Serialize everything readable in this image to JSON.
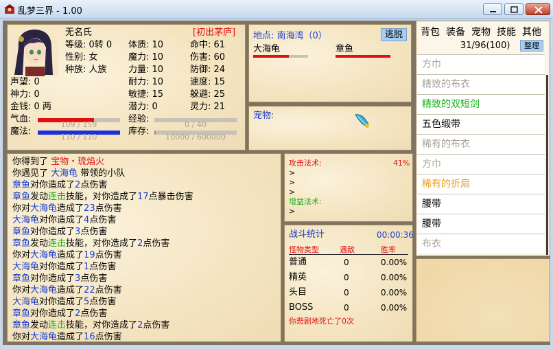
{
  "window": {
    "title": "乱梦三界 - 1.00"
  },
  "character": {
    "name": "无名氏",
    "location_tag": "[初出茅庐]",
    "level": "等级: 0转 0",
    "gender": "性别: 女",
    "race": "种族: 人族",
    "fame": "声望: 0",
    "spirit": "神力: 0",
    "money": "金钱: 0 两",
    "physique": "体质: 10",
    "magic_pow": "魔力: 10",
    "strength": "力量: 10",
    "endurance": "耐力: 10",
    "agility": "敏捷: 15",
    "potential": "潜力: 0",
    "hit": "命中: 61",
    "damage": "伤害: 60",
    "defense": "防御: 24",
    "speed": "速度: 15",
    "dodge": "躲避: 25",
    "spirit_power": "灵力: 21",
    "hp_label": "气血:",
    "hp_text": "109 / 159",
    "hp_fraction": 0.686,
    "mp_label": "魔法:",
    "mp_text": "110 / 110",
    "mp_fraction": 1.0,
    "exp_label": "经验:",
    "exp_text": "0 / 40",
    "exp_fraction": 0,
    "store_label": "库存:",
    "store_text": "10000 / 600000",
    "store_fraction": 0.017,
    "colors": {
      "hp": "#e01010",
      "mp": "#1a2fe0",
      "exp": "#c8c2b6"
    }
  },
  "location": {
    "label": "地点: 南海湾（0）",
    "flee_button": "逃脱",
    "monsters": [
      {
        "name": "大海龟",
        "hp_fraction": 0.65
      },
      {
        "name": "章鱼",
        "hp_fraction": 1.0
      }
    ]
  },
  "pet": {
    "label": "宠物:"
  },
  "log": {
    "lines": [
      [
        {
          "t": "你得到了 "
        },
        {
          "t": "宝物・琉焰火",
          "c": "red"
        }
      ],
      [
        {
          "t": "你遇见了 "
        },
        {
          "t": "大海龟",
          "c": "blue"
        },
        {
          "t": " 带领的小队"
        }
      ],
      [
        {
          "t": "章鱼",
          "c": "blue"
        },
        {
          "t": "对你造成了"
        },
        {
          "t": "2",
          "c": "num"
        },
        {
          "t": "点伤害"
        }
      ],
      [
        {
          "t": "章鱼",
          "c": "blue"
        },
        {
          "t": "发动"
        },
        {
          "t": "连击",
          "c": "green"
        },
        {
          "t": "技能，对你造成了"
        },
        {
          "t": "17",
          "c": "num"
        },
        {
          "t": "点暴击伤害"
        }
      ],
      [
        {
          "t": "你对"
        },
        {
          "t": "大海龟",
          "c": "blue"
        },
        {
          "t": "造成了"
        },
        {
          "t": "23",
          "c": "num"
        },
        {
          "t": "点伤害"
        }
      ],
      [
        {
          "t": "大海龟",
          "c": "blue"
        },
        {
          "t": "对你造成了"
        },
        {
          "t": "4",
          "c": "num"
        },
        {
          "t": "点伤害"
        }
      ],
      [
        {
          "t": "章鱼",
          "c": "blue"
        },
        {
          "t": "对你造成了"
        },
        {
          "t": "3",
          "c": "num"
        },
        {
          "t": "点伤害"
        }
      ],
      [
        {
          "t": "章鱼",
          "c": "blue"
        },
        {
          "t": "发动"
        },
        {
          "t": "连击",
          "c": "green"
        },
        {
          "t": "技能，对你造成了"
        },
        {
          "t": "2",
          "c": "num"
        },
        {
          "t": "点伤害"
        }
      ],
      [
        {
          "t": "你对"
        },
        {
          "t": "大海龟",
          "c": "blue"
        },
        {
          "t": "造成了"
        },
        {
          "t": "19",
          "c": "num"
        },
        {
          "t": "点伤害"
        }
      ],
      [
        {
          "t": "大海龟",
          "c": "blue"
        },
        {
          "t": "对你造成了"
        },
        {
          "t": "1",
          "c": "num"
        },
        {
          "t": "点伤害"
        }
      ],
      [
        {
          "t": "章鱼",
          "c": "blue"
        },
        {
          "t": "对你造成了"
        },
        {
          "t": "3",
          "c": "num"
        },
        {
          "t": "点伤害"
        }
      ],
      [
        {
          "t": "你对"
        },
        {
          "t": "大海龟",
          "c": "blue"
        },
        {
          "t": "造成了"
        },
        {
          "t": "22",
          "c": "num"
        },
        {
          "t": "点伤害"
        }
      ],
      [
        {
          "t": "大海龟",
          "c": "blue"
        },
        {
          "t": "对你造成了"
        },
        {
          "t": "5",
          "c": "num"
        },
        {
          "t": "点伤害"
        }
      ],
      [
        {
          "t": "章鱼",
          "c": "blue"
        },
        {
          "t": "对你造成了"
        },
        {
          "t": "2",
          "c": "num"
        },
        {
          "t": "点伤害"
        }
      ],
      [
        {
          "t": "章鱼",
          "c": "blue"
        },
        {
          "t": "发动"
        },
        {
          "t": "连击",
          "c": "green"
        },
        {
          "t": "技能，对你造成了"
        },
        {
          "t": "2",
          "c": "num"
        },
        {
          "t": "点伤害"
        }
      ],
      [
        {
          "t": "你对"
        },
        {
          "t": "大海龟",
          "c": "blue"
        },
        {
          "t": "造成了"
        },
        {
          "t": "16",
          "c": "num"
        },
        {
          "t": "点伤害"
        }
      ]
    ]
  },
  "spells": {
    "attack_label": "攻击法术:",
    "attack_pct": "41%",
    "arrow": ">",
    "buff_label": "增益法术:"
  },
  "battle": {
    "title": "战斗统计",
    "timer": "00:00:36",
    "headers": [
      "怪物类型",
      "遇敌",
      "胜率"
    ],
    "rows": [
      {
        "type": "普通",
        "count": "0",
        "rate": "0.00%"
      },
      {
        "type": "精英",
        "count": "0",
        "rate": "0.00%"
      },
      {
        "type": "头目",
        "count": "0",
        "rate": "0.00%"
      },
      {
        "type": "BOSS",
        "count": "0",
        "rate": "0.00%"
      }
    ],
    "death_text": "你悲剧地死亡了0次"
  },
  "inventory": {
    "tabs": [
      "背包",
      "装备",
      "宠物",
      "技能",
      "其他"
    ],
    "count": "31/96(100)",
    "sort_button": "整理",
    "items": [
      {
        "name": "方巾",
        "color": "#a8a196"
      },
      {
        "name": "精致的布衣",
        "color": "#a8a196"
      },
      {
        "name": "精致的双短剑",
        "color": "#18b018"
      },
      {
        "name": "五色缎带",
        "color": "#000000"
      },
      {
        "name": "稀有的布衣",
        "color": "#a8a196"
      },
      {
        "name": "方巾",
        "color": "#a8a196"
      },
      {
        "name": "稀有的折扇",
        "color": "#e8a020"
      },
      {
        "name": "腰带",
        "color": "#000000"
      },
      {
        "name": "腰带",
        "color": "#000000"
      },
      {
        "name": "布衣",
        "color": "#a8a196"
      }
    ]
  }
}
